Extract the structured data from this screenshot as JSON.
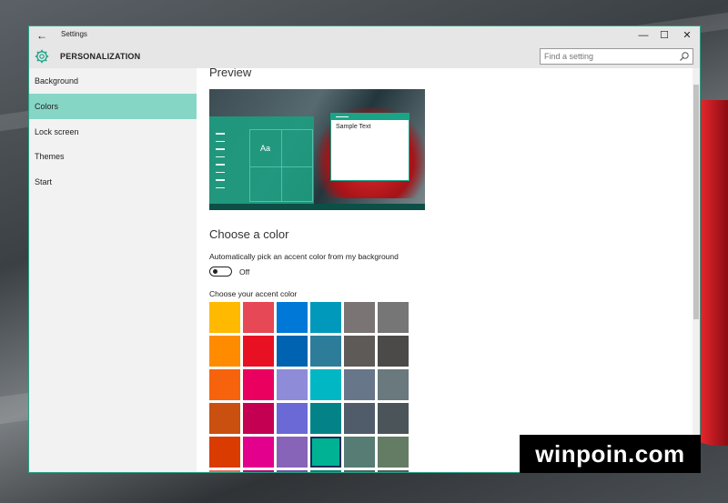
{
  "window": {
    "title": "Settings",
    "controls": {
      "minimize": "—",
      "maximize": "☐",
      "close": "✕"
    }
  },
  "header": {
    "title": "PERSONALIZATION",
    "search_placeholder": "Find a setting"
  },
  "sidebar": {
    "items": [
      {
        "label": "Background",
        "active": false
      },
      {
        "label": "Colors",
        "active": true
      },
      {
        "label": "Lock screen",
        "active": false
      },
      {
        "label": "Themes",
        "active": false
      },
      {
        "label": "Start",
        "active": false
      }
    ]
  },
  "main": {
    "preview_heading": "Preview",
    "preview": {
      "tile_text": "Aa",
      "sample_text": "Sample Text"
    },
    "choose_heading": "Choose a color",
    "auto_pick_label": "Automatically pick an accent color from my background",
    "auto_pick_state": "Off",
    "accent_label": "Choose your accent color",
    "swatches": [
      [
        "#ffb900",
        "#e74856",
        "#0078d7",
        "#0099bc",
        "#7a7574",
        "#767676"
      ],
      [
        "#ff8c00",
        "#e81123",
        "#0063b1",
        "#2d7d9a",
        "#5d5a58",
        "#4c4a48"
      ],
      [
        "#f7630c",
        "#ea005e",
        "#8e8cd8",
        "#00b7c3",
        "#68768a",
        "#69797e"
      ],
      [
        "#ca5010",
        "#c30052",
        "#6b69d6",
        "#038387",
        "#515c6b",
        "#4a5459"
      ],
      [
        "#da3b01",
        "#e3008c",
        "#8764b8",
        "#00b294",
        "#567c73",
        "#647c64"
      ],
      [
        "#ef6950",
        "#bf0077",
        "#744da9",
        "#018574",
        "#486860",
        "#525e54"
      ]
    ],
    "selected_swatch": "#00b294"
  },
  "watermark": "winpoin.com",
  "colors": {
    "accent": "#1aa487",
    "nav_active": "#86d6c6"
  }
}
